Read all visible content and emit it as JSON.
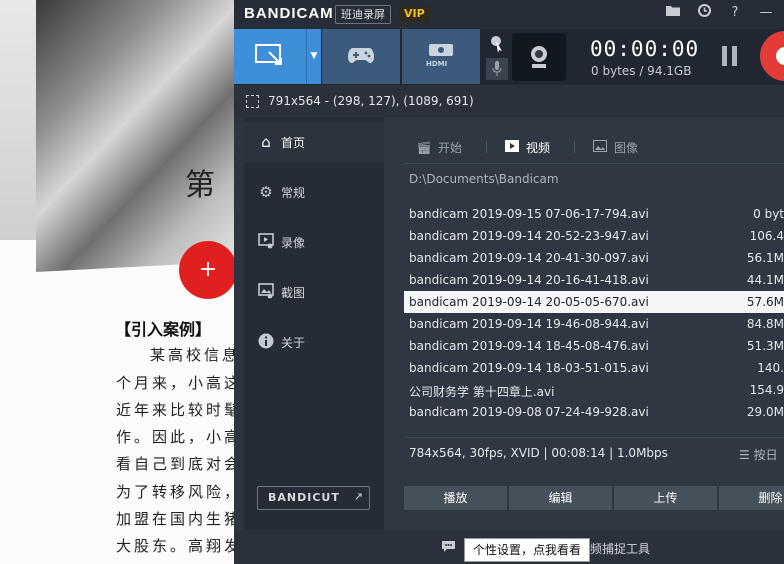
{
  "document": {
    "chapter": "第",
    "heading": "【引入案例】",
    "lines": [
      "某高校信息",
      "个月来，小高这",
      "近年来比较时髦",
      "作。因此，小高",
      "看自己到底对会",
      "为了转移风险，",
      "加盟在国内生猪",
      "大股东。高翔发"
    ]
  },
  "app": {
    "logo": "BANDICAM",
    "logo_cn": "班迪录屏",
    "vip": "VIP",
    "timer": "00:00:00",
    "size": "0 bytes / 94.1GB",
    "hdmi_label": "HDMI",
    "region": "791x564 - (298, 127), (1089, 691)",
    "accent": "#3f8ed8",
    "record_color": "#e33a3a"
  },
  "sidebar": {
    "items": [
      {
        "label": "首页",
        "icon": "home-icon"
      },
      {
        "label": "常规",
        "icon": "gear-icon"
      },
      {
        "label": "录像",
        "icon": "video-settings-icon"
      },
      {
        "label": "截图",
        "icon": "image-settings-icon"
      },
      {
        "label": "关于",
        "icon": "info-icon"
      }
    ],
    "bandicut": "BANDICUT"
  },
  "content": {
    "tabs": [
      {
        "label": "开始",
        "icon": "clapper-icon"
      },
      {
        "label": "视频",
        "icon": "play-icon"
      },
      {
        "label": "图像",
        "icon": "picture-icon"
      }
    ],
    "path": "D:\\Documents\\Bandicam",
    "files": [
      {
        "name": "bandicam 2019-09-15 07-06-17-794.avi",
        "size": "0 byt"
      },
      {
        "name": "bandicam 2019-09-14 20-52-23-947.avi",
        "size": "106.4"
      },
      {
        "name": "bandicam 2019-09-14 20-41-30-097.avi",
        "size": "56.1M"
      },
      {
        "name": "bandicam 2019-09-14 20-16-41-418.avi",
        "size": "44.1M"
      },
      {
        "name": "bandicam 2019-09-14 20-05-05-670.avi",
        "size": "57.6M"
      },
      {
        "name": "bandicam 2019-09-14 19-46-08-944.avi",
        "size": "84.8M"
      },
      {
        "name": "bandicam 2019-09-14 18-45-08-476.avi",
        "size": "51.3M"
      },
      {
        "name": "bandicam 2019-09-14 18-03-51-015.avi",
        "size": "140."
      },
      {
        "name": "公司财务学 第十四章上.avi",
        "size": "154.9"
      },
      {
        "name": "bandicam 2019-09-08 07-24-49-928.avi",
        "size": "29.0M"
      }
    ],
    "selected_index": 4,
    "file_info": "784x564, 30fps, XVID | 00:08:14 | 1.0Mbps",
    "sort_label": "按日",
    "actions": [
      "播放",
      "编辑",
      "上传",
      "删除"
    ]
  },
  "status": {
    "tooltip": "个性设置，点我看看",
    "tail": "频捕捉工具"
  }
}
